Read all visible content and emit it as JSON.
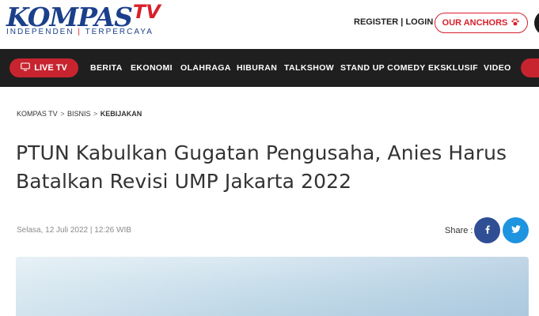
{
  "header": {
    "logo_main": "KOMPAS",
    "logo_tv": "TV",
    "tagline_left": "INDEPENDEN",
    "tagline_sep": "|",
    "tagline_right": "TERPERCAYA",
    "register_label": "REGISTER",
    "auth_sep": "|",
    "login_label": "LOGIN",
    "anchors_label": "OUR ANCHORS"
  },
  "nav": {
    "live_label": "LIVE TV",
    "items": [
      "BERITA",
      "EKONOMI",
      "OLAHRAGA",
      "HIBURAN",
      "TALKSHOW",
      "STAND UP COMEDY",
      "EKSKLUSIF",
      "VIDEO"
    ]
  },
  "breadcrumb": {
    "items": [
      "KOMPAS TV",
      "BISNIS",
      "KEBIJAKAN"
    ],
    "separator": ">"
  },
  "article": {
    "title": "PTUN Kabulkan Gugatan Pengusaha, Anies Harus Batalkan Revisi UMP Jakarta 2022",
    "date": "Selasa, 12 Juli 2022 | 12:26 WIB",
    "share_label": "Share :"
  },
  "colors": {
    "brand_blue": "#1b3f8b",
    "brand_red": "#d7202b",
    "nav_bg": "#1f1f1f",
    "facebook": "#2f4e93",
    "twitter": "#1e93e0"
  },
  "icons": {
    "live": "tv-icon",
    "anchors": "paw-icon",
    "facebook": "facebook-icon",
    "twitter": "twitter-icon"
  }
}
